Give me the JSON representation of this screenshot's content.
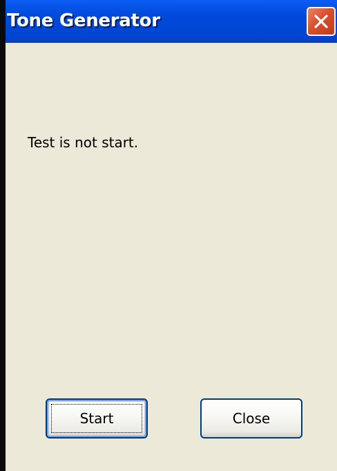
{
  "window": {
    "title": "Tone Generator"
  },
  "status": {
    "message": "Test is not start."
  },
  "buttons": {
    "start_label": "Start",
    "close_label": "Close"
  },
  "icons": {
    "title_close": "close-icon"
  },
  "colors": {
    "titlebar": "#0047d6",
    "body": "#ece9d8",
    "close_button": "#d8502d",
    "button_border": "#003c74"
  }
}
